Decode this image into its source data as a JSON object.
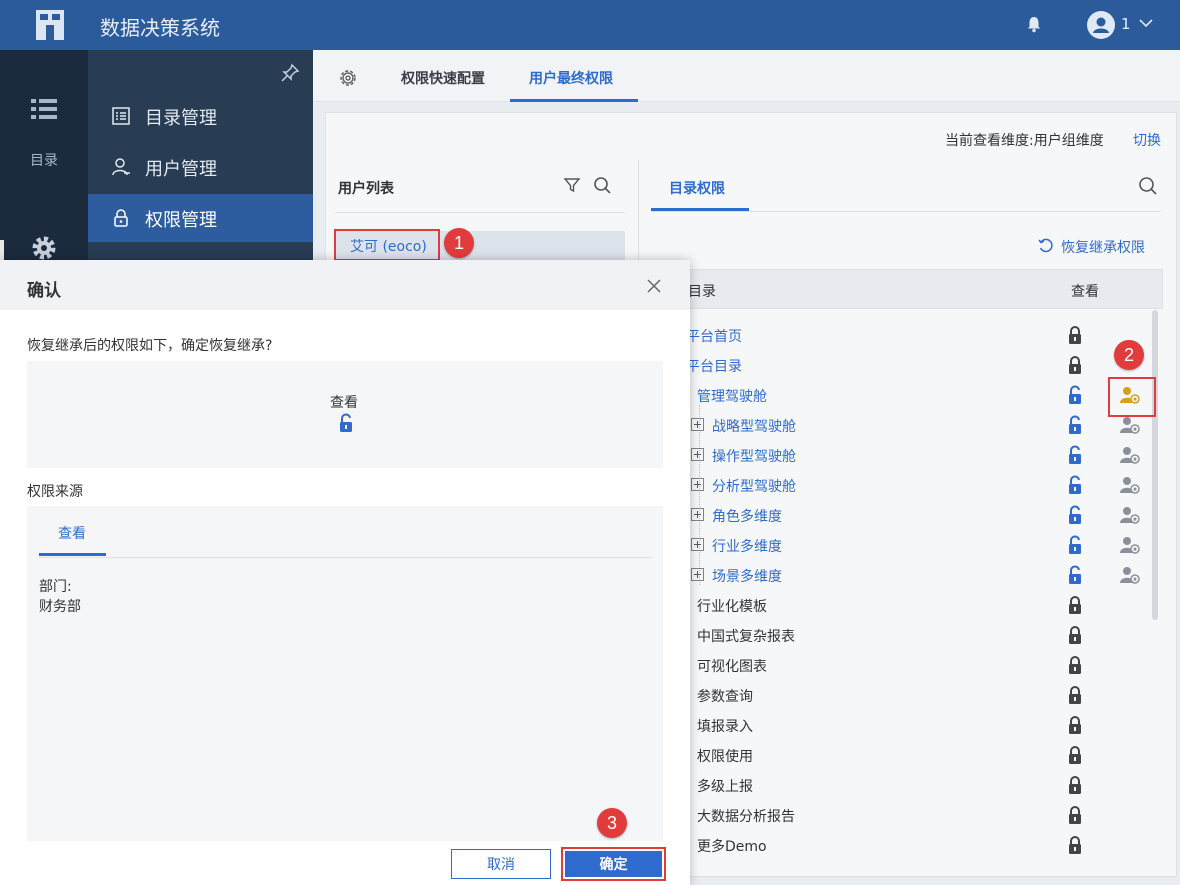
{
  "app": {
    "title": "数据决策系统",
    "user": "1"
  },
  "rail": {
    "label": "目录"
  },
  "nav": [
    {
      "label": "目录管理",
      "icon": "list-icon"
    },
    {
      "label": "用户管理",
      "icon": "user-manage-icon"
    },
    {
      "label": "权限管理",
      "icon": "lock-icon"
    }
  ],
  "tabs": [
    {
      "label": "权限快速配置"
    },
    {
      "label": "用户最终权限"
    }
  ],
  "header": {
    "dimension_text": "当前查看维度:用户组维度",
    "switch": "切换"
  },
  "user_panel": {
    "title": "用户列表",
    "selected_user": "艾可 (eoco)"
  },
  "perm_panel": {
    "tab": "目录权限",
    "restore": "恢复继承权限",
    "col_dir": "目录",
    "col_view": "查看",
    "rows": [
      {
        "label": "平台首页",
        "color": "#2f6bce",
        "lock": "locked",
        "icon": ""
      },
      {
        "label": "平台目录",
        "color": "#2f6bce",
        "lock": "locked",
        "icon": ""
      },
      {
        "label": "管理驾驶舱",
        "color": "#2f6bce",
        "lock": "unlocked",
        "icon": "gold"
      },
      {
        "label": "战略型驾驶舱",
        "color": "#2f6bce",
        "lock": "unlocked",
        "icon": "grey",
        "plus": true
      },
      {
        "label": "操作型驾驶舱",
        "color": "#2f6bce",
        "lock": "unlocked",
        "icon": "grey",
        "plus": true
      },
      {
        "label": "分析型驾驶舱",
        "color": "#2f6bce",
        "lock": "unlocked",
        "icon": "grey",
        "plus": true
      },
      {
        "label": "角色多维度",
        "color": "#2f6bce",
        "lock": "unlocked",
        "icon": "grey",
        "plus": true
      },
      {
        "label": "行业多维度",
        "color": "#2f6bce",
        "lock": "unlocked",
        "icon": "grey",
        "plus": true
      },
      {
        "label": "场景多维度",
        "color": "#2f6bce",
        "lock": "unlocked",
        "icon": "grey",
        "plus": true
      },
      {
        "label": "行业化模板",
        "color": "#333333",
        "lock": "locked",
        "icon": ""
      },
      {
        "label": "中国式复杂报表",
        "color": "#333333",
        "lock": "locked",
        "icon": ""
      },
      {
        "label": "可视化图表",
        "color": "#333333",
        "lock": "locked",
        "icon": ""
      },
      {
        "label": "参数查询",
        "color": "#333333",
        "lock": "locked",
        "icon": ""
      },
      {
        "label": "填报录入",
        "color": "#333333",
        "lock": "locked",
        "icon": ""
      },
      {
        "label": "权限使用",
        "color": "#333333",
        "lock": "locked",
        "icon": ""
      },
      {
        "label": "多级上报",
        "color": "#333333",
        "lock": "locked",
        "icon": ""
      },
      {
        "label": "大数据分析报告",
        "color": "#333333",
        "lock": "locked",
        "icon": ""
      },
      {
        "label": "更多Demo",
        "color": "#333333",
        "lock": "locked",
        "icon": ""
      }
    ]
  },
  "dialog": {
    "title": "确认",
    "message": "恢复继承后的权限如下，确定恢复继承?",
    "perm_label": "查看",
    "source_title": "权限来源",
    "source_tab": "查看",
    "source_line1": "部门:",
    "source_line2": "财务部",
    "cancel": "取消",
    "ok": "确定"
  },
  "callouts": [
    "1",
    "2",
    "3"
  ],
  "colors": {
    "accent": "#2f6bce",
    "topbar": "#2c5b9c",
    "callout": "#e03c3c"
  }
}
